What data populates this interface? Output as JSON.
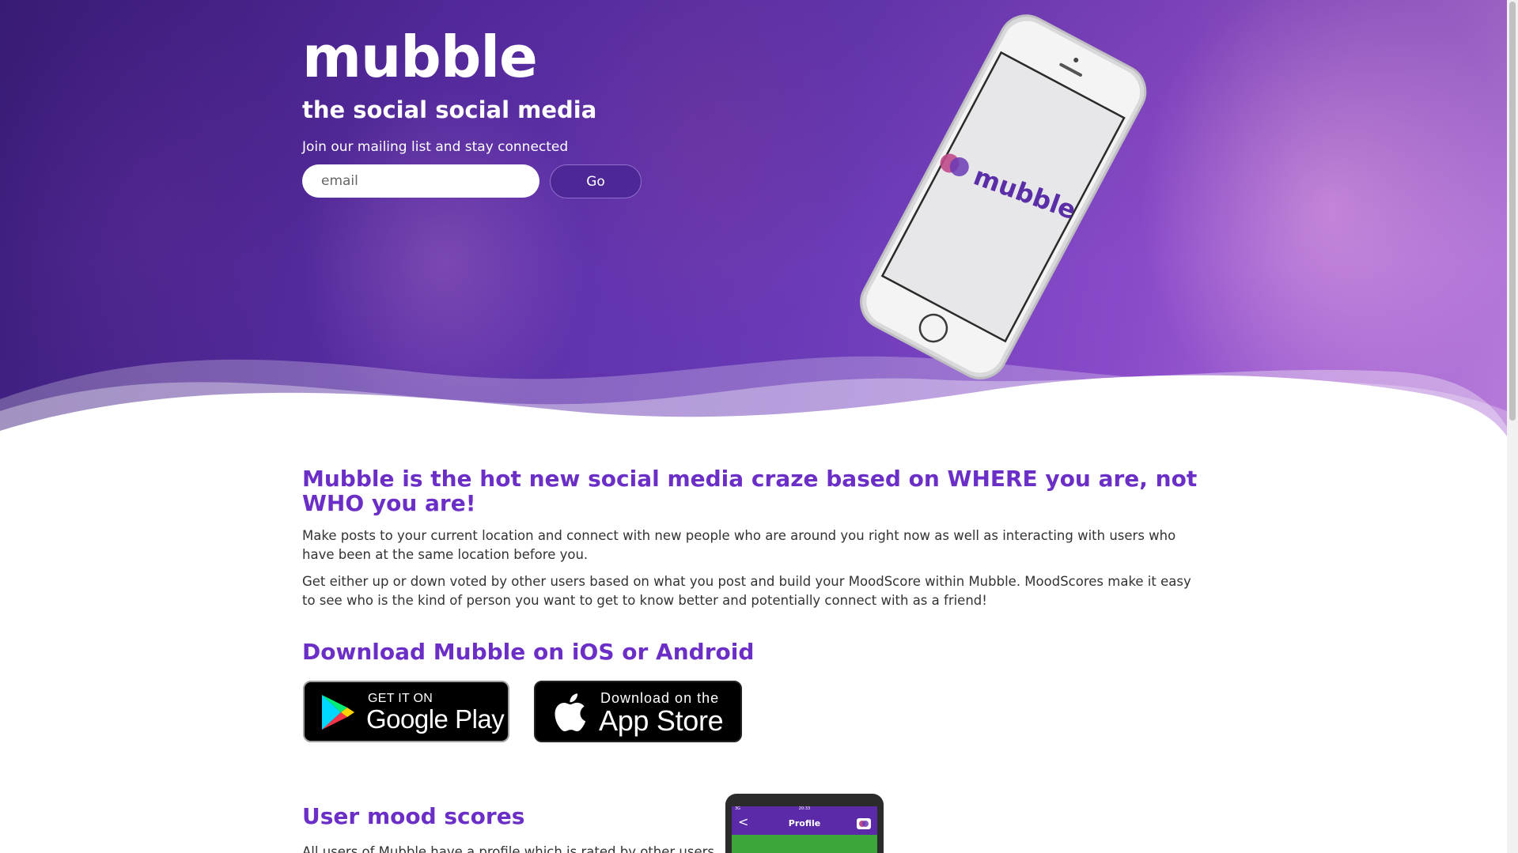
{
  "hero": {
    "brand": "mubble",
    "tagline": "the social social media",
    "mailing_text": "Join our mailing list and stay connected",
    "email_placeholder": "email",
    "go_label": "Go",
    "phone_screen_logo": "mubble"
  },
  "intro": {
    "headline": "Mubble is the hot new social media craze based on WHERE you are, not WHO you are!",
    "paragraphs": [
      "Make posts to your current location and connect with new people who are around you right now as well as interacting with users who have been at the same location before you.",
      "Get either up or down voted by other users based on what you post and build your MoodScore within Mubble. MoodScores make it easy to see who is the kind of person you want to get to know better and potentially connect with as a friend!"
    ]
  },
  "download": {
    "title": "Download Mubble on iOS or Android",
    "google_play": {
      "small": "GET IT ON",
      "big": "Google Play"
    },
    "app_store": {
      "small": "Download on the",
      "big": "App Store"
    }
  },
  "mood": {
    "title": "User mood scores",
    "text": "All users of Mubble have a profile which is rated by other users"
  },
  "mini_phone": {
    "status_time": "20:33",
    "status_left": "3G",
    "screen_title": "Profile",
    "back": "<"
  },
  "colors": {
    "accent": "#6b2fc7",
    "go_button": "#4e2796",
    "hero_start": "#3b1e7a",
    "hero_end": "#b67ad9"
  }
}
